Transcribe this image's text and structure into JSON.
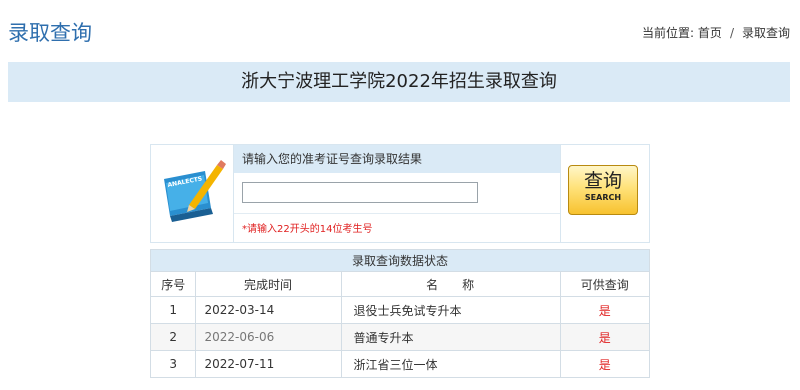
{
  "header": {
    "title": "录取查询",
    "breadcrumb": {
      "prefix": "当前位置:",
      "home": "首页",
      "separator": "/",
      "current": "录取查询"
    }
  },
  "banner": {
    "text": "浙大宁波理工学院2022年招生录取查询"
  },
  "search": {
    "image_text": "ANALECTS",
    "prompt": "请输入您的准考证号查询录取结果",
    "input_value": "",
    "hint": "*请输入22开头的14位考生号",
    "button_label": "查询",
    "button_sublabel": "SEARCH"
  },
  "status_table": {
    "caption": "录取查询数据状态",
    "headers": [
      "序号",
      "完成时间",
      "名　　称",
      "可供查询"
    ],
    "rows": [
      {
        "idx": "1",
        "date": "2022-03-14",
        "name": "退役士兵免试专升本",
        "available": "是"
      },
      {
        "idx": "2",
        "date": "2022-06-06",
        "name": "普通专升本",
        "available": "是"
      },
      {
        "idx": "3",
        "date": "2022-07-11",
        "name": "浙江省三位一体",
        "available": "是"
      }
    ]
  },
  "colors": {
    "accent": "#2f6fae",
    "banner_bg": "#daeaf6",
    "hint_red": "#e02020",
    "button_gold": "#f7c22f"
  }
}
